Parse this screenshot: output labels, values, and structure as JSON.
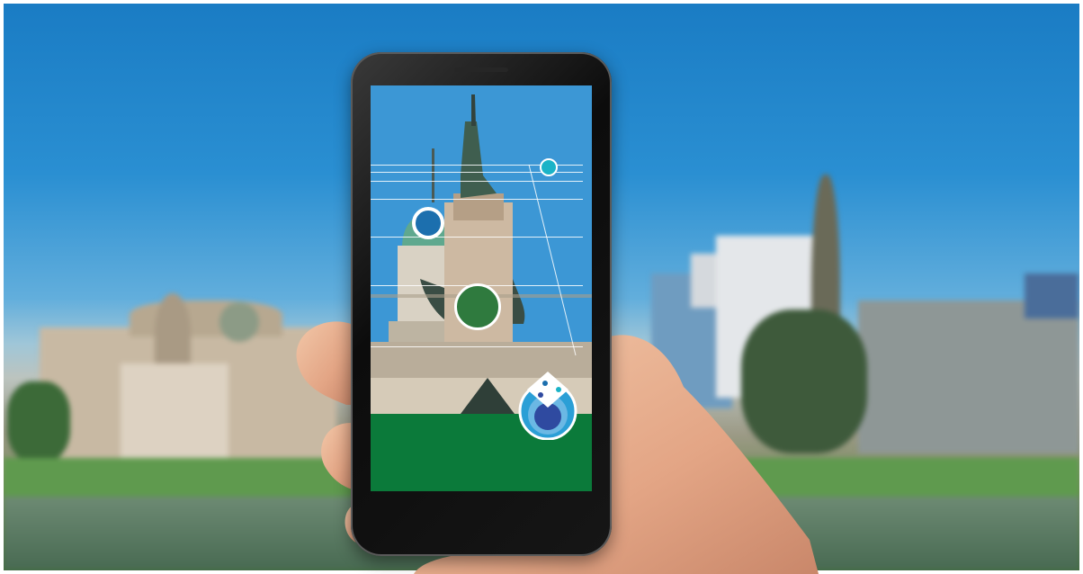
{
  "scene": {
    "description_icon": "augmented-reality-phone",
    "colors": {
      "sky": "#2a8fd2",
      "grass": "#0b7a3a",
      "marker_blue": "#1c6fae",
      "marker_green": "#2f7a3e",
      "marker_cyan": "#1bb3c7",
      "stone": "#c9bca8"
    }
  },
  "ar_overlay": {
    "markers": [
      {
        "name": "blue-marker",
        "color": "#1c6fae"
      },
      {
        "name": "green-marker",
        "color": "#2f7a3e"
      },
      {
        "name": "cyan-marker",
        "color": "#1bb3c7"
      }
    ],
    "app_badge_icon": "ar-app-logo-icon"
  }
}
